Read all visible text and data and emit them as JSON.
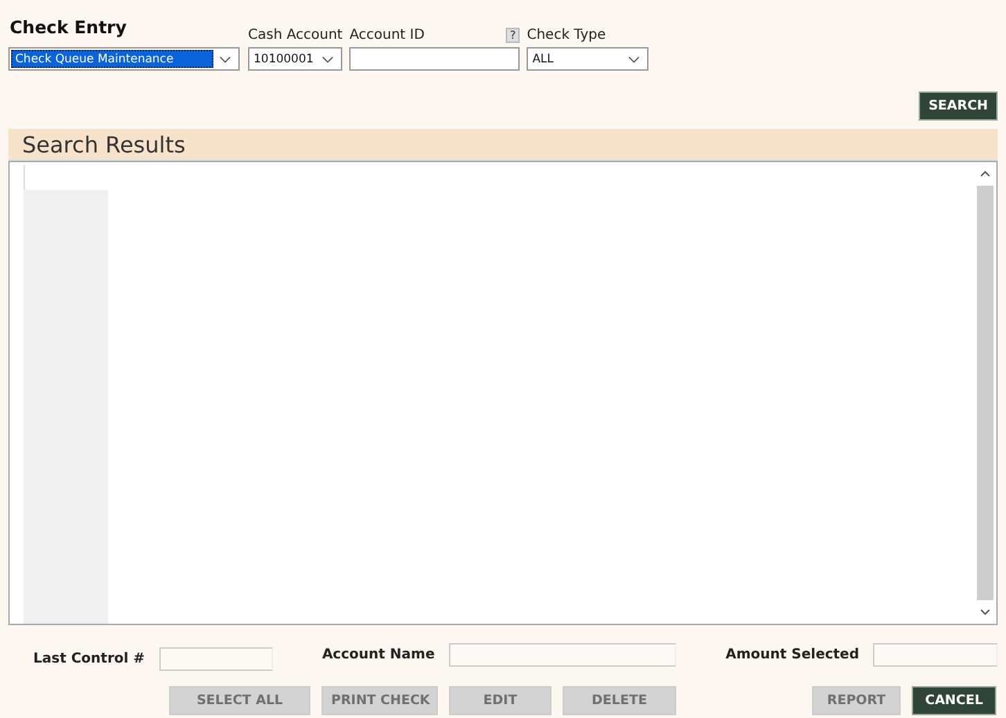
{
  "title": "Check Entry",
  "mode_select": {
    "value": "Check Queue Maintenance",
    "focused": true
  },
  "filters": [
    {
      "kind": "dropdown",
      "label": "Cash Account",
      "value": "10100001"
    },
    {
      "kind": "text",
      "label": "Account ID",
      "help": "?"
    },
    {
      "kind": "dropdown",
      "label": "Check Type",
      "value": "ALL"
    }
  ],
  "search_button": {
    "label": "SEARCH",
    "disabled": false
  },
  "results": {
    "title": "Search Results"
  },
  "summary": [
    {
      "label": "Last Control #"
    },
    {
      "label": "Account Name"
    },
    {
      "label": "Amount Selected"
    }
  ],
  "actions_left": [
    {
      "label": "SELECT ALL",
      "disabled": true
    },
    {
      "label": "PRINT CHECK",
      "disabled": true
    },
    {
      "label": "EDIT",
      "disabled": true
    },
    {
      "label": "DELETE",
      "disabled": true
    }
  ],
  "actions_right": [
    {
      "label": "REPORT",
      "disabled": true
    },
    {
      "label": "CANCEL",
      "disabled": false
    }
  ]
}
